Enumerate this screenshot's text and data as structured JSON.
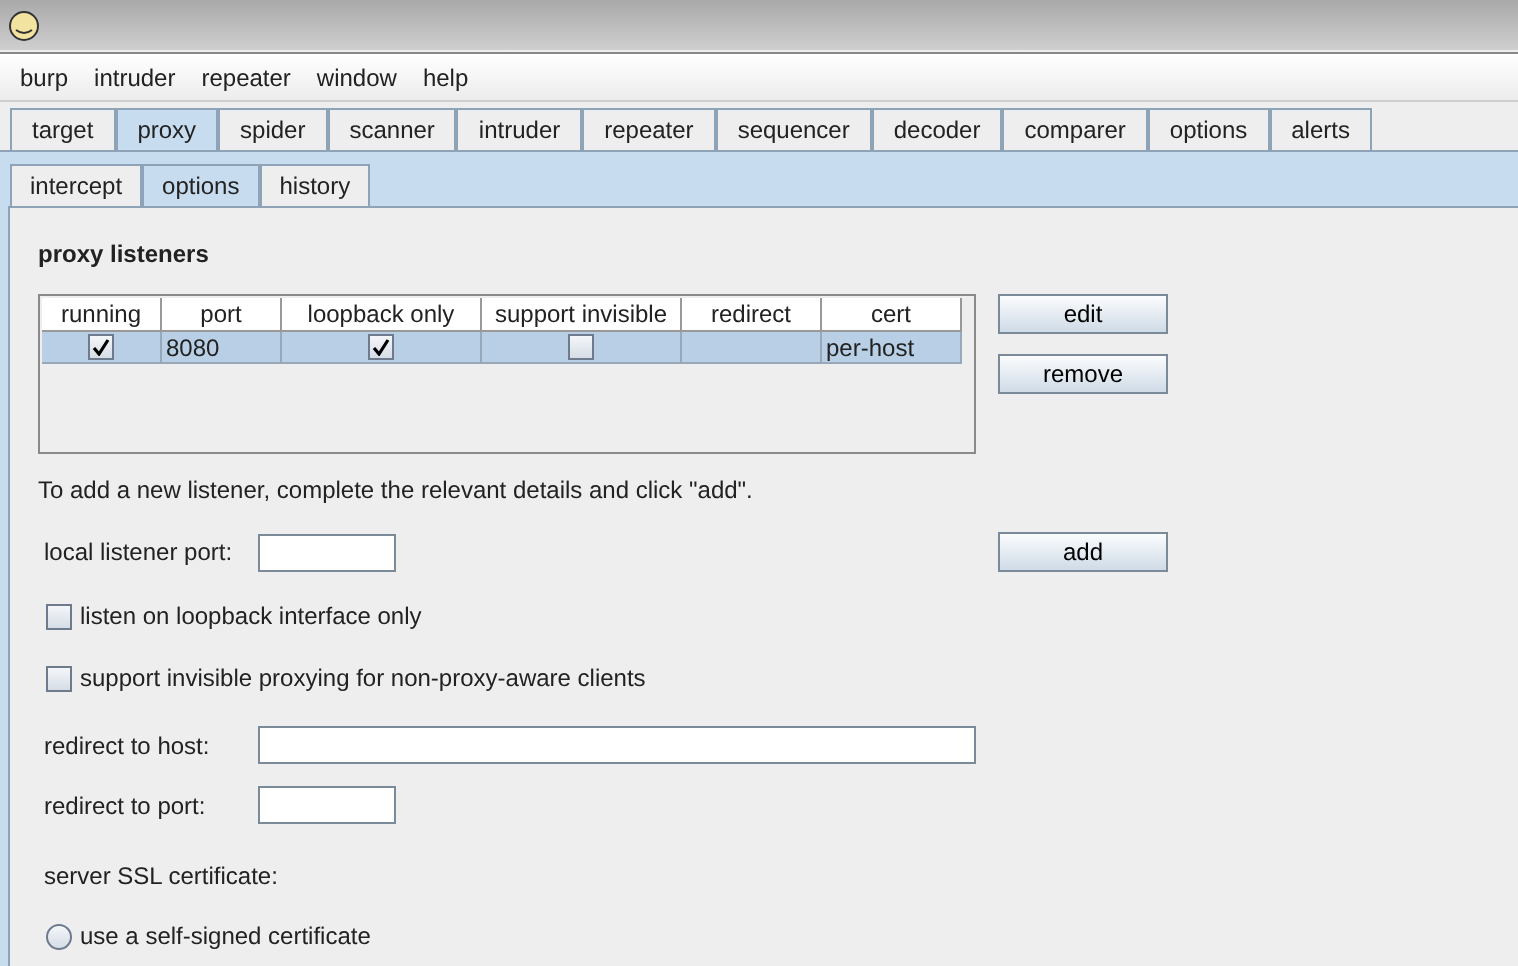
{
  "menu": [
    "burp",
    "intruder",
    "repeater",
    "window",
    "help"
  ],
  "tabs": [
    {
      "label": "target",
      "selected": false
    },
    {
      "label": "proxy",
      "selected": true
    },
    {
      "label": "spider",
      "selected": false
    },
    {
      "label": "scanner",
      "selected": false
    },
    {
      "label": "intruder",
      "selected": false
    },
    {
      "label": "repeater",
      "selected": false
    },
    {
      "label": "sequencer",
      "selected": false
    },
    {
      "label": "decoder",
      "selected": false
    },
    {
      "label": "comparer",
      "selected": false
    },
    {
      "label": "options",
      "selected": false
    },
    {
      "label": "alerts",
      "selected": false
    }
  ],
  "subtabs": [
    {
      "label": "intercept",
      "selected": false
    },
    {
      "label": "options",
      "selected": true
    },
    {
      "label": "history",
      "selected": false
    }
  ],
  "section_title": "proxy listeners",
  "table": {
    "columns": [
      "running",
      "port",
      "loopback only",
      "support invisible",
      "redirect",
      "cert"
    ],
    "rows": [
      {
        "selected": true,
        "running": true,
        "port": "8080",
        "loopback_only": true,
        "support_invisible": false,
        "redirect": "",
        "cert": "per-host"
      }
    ]
  },
  "table_buttons": [
    "edit",
    "remove"
  ],
  "hint": "To add a new listener, complete the relevant details and click \"add\".",
  "local_port": {
    "label": "local listener port:"
  },
  "add_button": "add",
  "checkboxes": [
    {
      "label": "listen on loopback interface only",
      "checked": false
    },
    {
      "label": "support invisible proxying for non-proxy-aware clients",
      "checked": false
    }
  ],
  "redirect_host": {
    "label": "redirect to host:"
  },
  "redirect_port": {
    "label": "redirect to port:"
  },
  "ssl_title": "server SSL certificate:",
  "ssl_options": [
    {
      "label": "use a self-signed certificate",
      "selected": false
    }
  ]
}
